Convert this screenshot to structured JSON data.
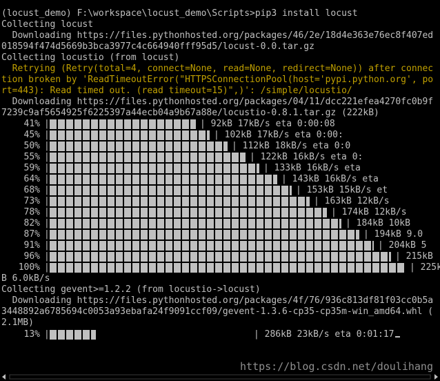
{
  "terminal": {
    "colors": {
      "background": "#000000",
      "text": "#c0c0c0",
      "warning": "#c0a000",
      "bar": "#c0c0c0",
      "watermark": "#8f8f8f"
    },
    "prompt": "(locust_demo) F:\\workspace\\locust_demo\\Scripts>",
    "command": "pip3 install locust",
    "lines": {
      "collecting_locust": "Collecting locust",
      "downloading_locust": "  Downloading https://files.pythonhosted.org/packages/46/2e/18d4e363e76ec8f407ed",
      "locust_hash": "018594f474d5669b3bca3977c4c664940fff95d5/locust-0.0.tar.gz",
      "collecting_locustio": "Collecting locustio (from locust)",
      "retry_1": "  Retrying (Retry(total=4, connect=None, read=None, redirect=None)) after connec",
      "retry_2": "tion broken by 'ReadTimeoutError(\"HTTPSConnectionPool(host='pypi.python.org', po",
      "retry_3": "rt=443): Read timed out. (read timeout=15)\",)': /simple/locustio/",
      "downloading_locustio": "  Downloading https://files.pythonhosted.org/packages/04/11/dcc221efea4270fc0b9f",
      "locustio_hash": "7239c9af5654925f6225397a44ecb04a9b67a88e/locustio-0.8.1.tar.gz (222kB)",
      "wrap_tail": "B 6.0kB/s",
      "collecting_gevent": "Collecting gevent>=1.2.2 (from locustio->locust)",
      "downloading_gevent": "  Downloading https://files.pythonhosted.org/packages/4f/76/936c813df81f03cc0b5a",
      "gevent_hash": "3448892a6785694c0053a93ebafa24f9091ccf09/gevent-1.3.6-cp35-cp35m-win_amd64.whl (",
      "gevent_size": "2.1MB)"
    },
    "progress_rows": [
      {
        "pct": "41%",
        "fill": 0.41,
        "stat": "| 92kB 17kB/s eta 0:00:08"
      },
      {
        "pct": "45%",
        "fill": 0.45,
        "stat": "| 102kB 17kB/s eta 0:00:"
      },
      {
        "pct": "50%",
        "fill": 0.5,
        "stat": "| 112kB 18kB/s eta 0:0"
      },
      {
        "pct": "55%",
        "fill": 0.55,
        "stat": "| 122kB 16kB/s eta 0:"
      },
      {
        "pct": "59%",
        "fill": 0.59,
        "stat": "| 133kB 16kB/s eta"
      },
      {
        "pct": "64%",
        "fill": 0.64,
        "stat": "| 143kB 16kB/s eta"
      },
      {
        "pct": "68%",
        "fill": 0.68,
        "stat": "| 153kB 15kB/s et"
      },
      {
        "pct": "73%",
        "fill": 0.73,
        "stat": "| 163kB 12kB/s"
      },
      {
        "pct": "78%",
        "fill": 0.78,
        "stat": "| 174kB 12kB/s"
      },
      {
        "pct": "82%",
        "fill": 0.82,
        "stat": "| 184kB 10kB"
      },
      {
        "pct": "87%",
        "fill": 0.87,
        "stat": "| 194kB 9.0"
      },
      {
        "pct": "91%",
        "fill": 0.91,
        "stat": "| 204kB 5"
      },
      {
        "pct": "96%",
        "fill": 0.96,
        "stat": "| 215kB"
      },
      {
        "pct": "100%",
        "fill": 1.0,
        "stat": "| 225k"
      }
    ],
    "gevent_progress": {
      "pct": "13%",
      "fill": 0.13,
      "stat": "| 286kB 23kB/s eta 0:01:17"
    },
    "watermark": "https://blog.csdn.net/doulihang"
  }
}
